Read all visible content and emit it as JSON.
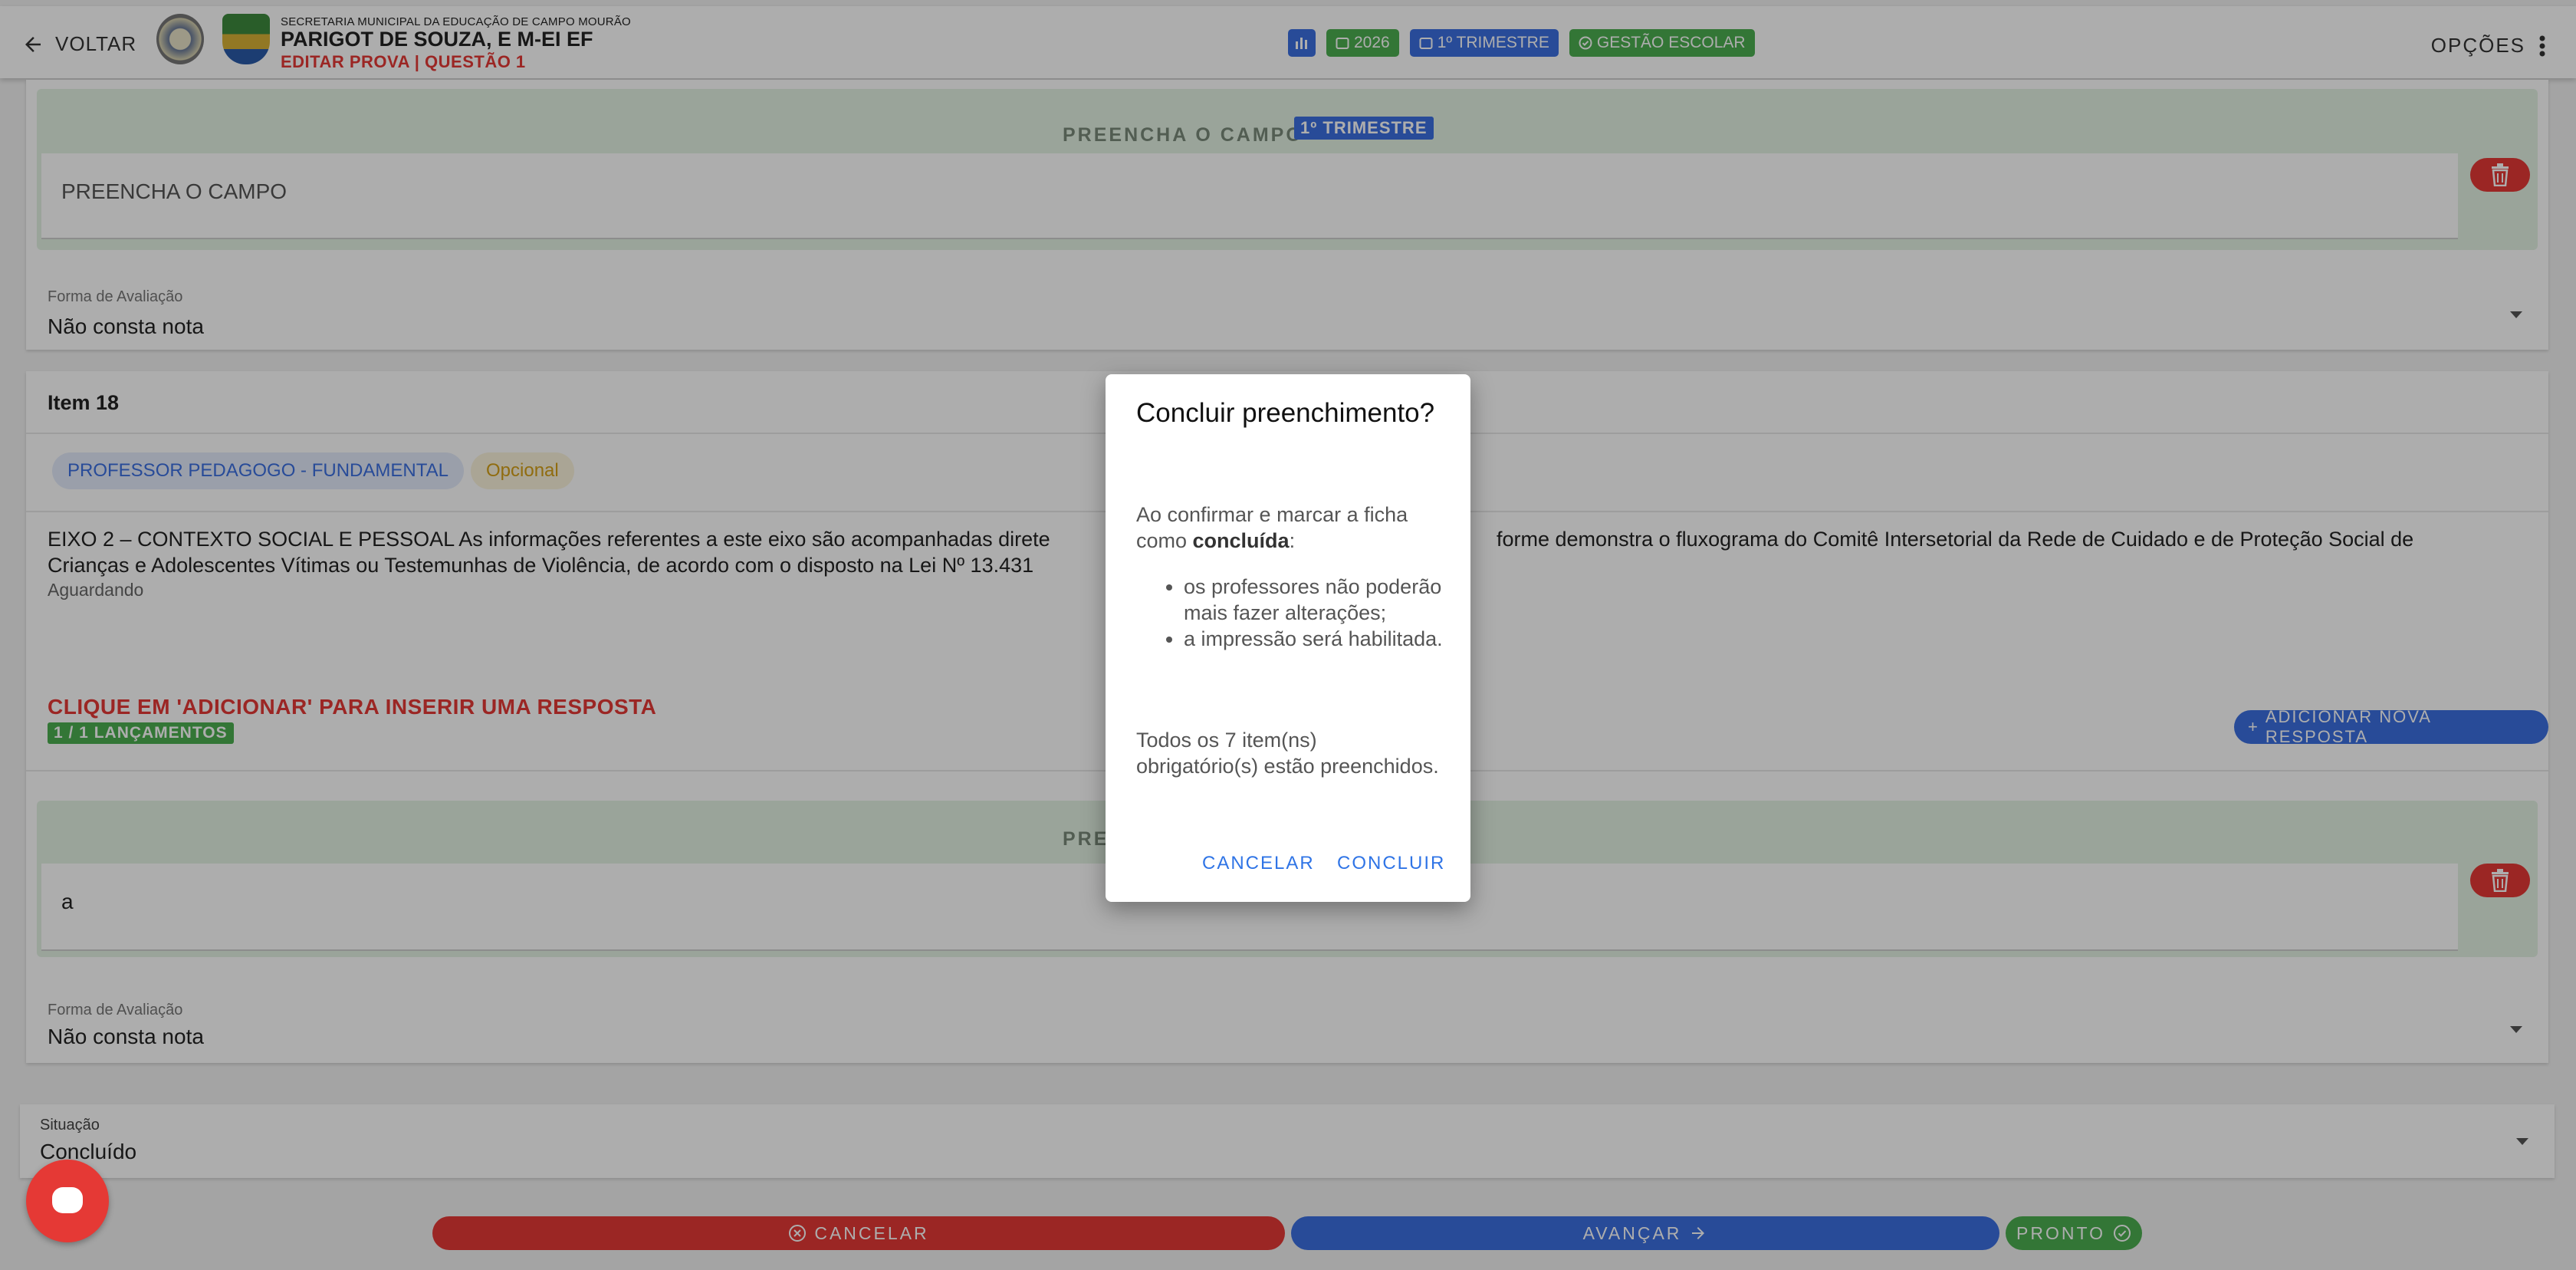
{
  "header": {
    "back_label": "VOLTAR",
    "subtitle": "SECRETARIA MUNICIPAL DA EDUCAÇÃO DE CAMPO MOURÃO",
    "title": "PARIGOT DE SOUZA, E M-EI EF",
    "edit_label": "EDITAR PROVA | QUESTÃO 1",
    "chips": {
      "year": "2026",
      "term": "1º TRIMESTRE",
      "system": "GESTÃO ESCOLAR"
    },
    "options_label": "OPÇÕES"
  },
  "block1": {
    "fill_title": "PREENCHA O CAMPO",
    "term_tag": "1º TRIMESTRE",
    "field_value": "PREENCHA O CAMPO",
    "eval_label": "Forma de Avaliação",
    "eval_value": "Não consta nota"
  },
  "item18": {
    "title": "Item 18",
    "role_chip": "PROFESSOR PEDAGOGO - FUNDAMENTAL",
    "optional_chip": "Opcional",
    "text_left": "EIXO 2 – CONTEXTO SOCIAL E PESSOAL As informações referentes a este eixo são acompanhadas direte",
    "text_right": "forme demonstra o fluxograma do Comitê Intersetorial da Rede de Cuidado e de Proteção Social de",
    "text_line2": "Crianças e Adolescentes Vítimas ou Testemunhas de Violência, de acordo com o disposto na Lei Nº 13.431",
    "status": "Aguardando",
    "prompt": "CLIQUE EM 'ADICIONAR' PARA INSERIR UMA RESPOSTA",
    "count_badge": "1 / 1 LANÇAMENTOS",
    "add_button": "ADICIONAR NOVA RESPOSTA",
    "fill_title_partial": "PRE",
    "answer_value": "a",
    "eval_label": "Forma de Avaliação",
    "eval_value": "Não consta nota"
  },
  "situacao": {
    "label": "Situação",
    "value": "Concluído"
  },
  "footer": {
    "cancel": "CANCELAR",
    "next": "AVANÇAR",
    "done": "PRONTO"
  },
  "dialog": {
    "title": "Concluir preenchimento?",
    "intro_a": "Ao confirmar e marcar a ficha como ",
    "intro_bold": "concluída",
    "intro_b": ":",
    "bullets": [
      "os professores não poderão mais fazer alterações;",
      "a impressão será habilitada."
    ],
    "summary": "Todos os 7 item(ns) obrigatório(s) estão preenchidos.",
    "cancel": "CANCELAR",
    "confirm": "CONCLUIR"
  },
  "colors": {
    "primary": "#3b6fe0",
    "danger": "#e53935",
    "success": "#4caf50",
    "warning": "#d4a017"
  }
}
